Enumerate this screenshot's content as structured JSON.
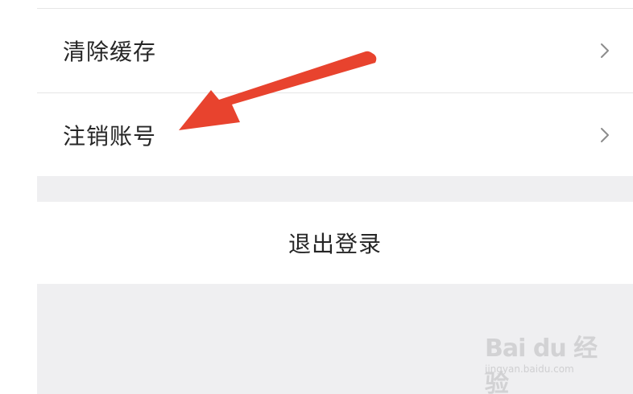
{
  "settings": {
    "items": [
      {
        "label": "清除缓存",
        "chevron": "chevron-right-icon"
      },
      {
        "label": "注销账号",
        "chevron": "chevron-right-icon"
      }
    ],
    "logout_label": "退出登录"
  },
  "annotation": {
    "icon": "red-arrow-icon",
    "color": "#e8432e"
  },
  "watermark": {
    "logo": "Bai du 经验",
    "url": "jingyan.baidu.com"
  },
  "colors": {
    "background": "#ffffff",
    "section_gap": "#efeff1",
    "divider": "#e6e6e6",
    "text": "#262626",
    "chevron": "#8c8c8c"
  }
}
